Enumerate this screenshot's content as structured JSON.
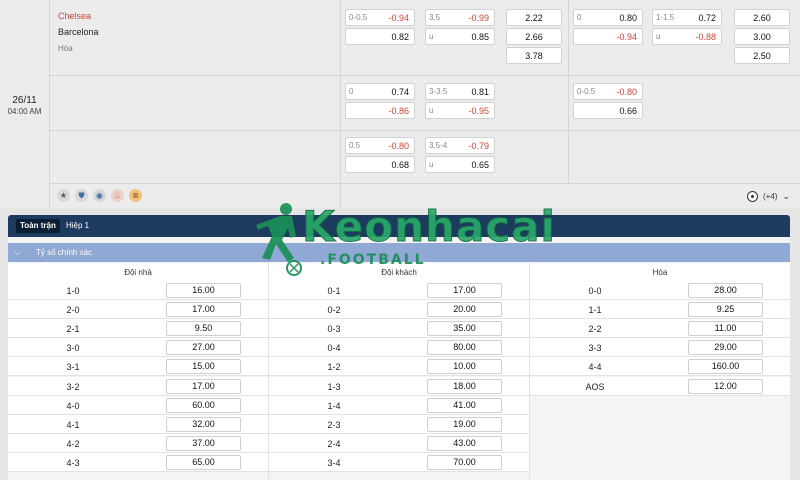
{
  "match": {
    "date": "26/11",
    "time": "04:00 AM",
    "home": "Chelsea",
    "away": "Barcelona",
    "draw": "Hòa",
    "more_count": "(+4)"
  },
  "odds": {
    "r1_hcap": {
      "h1": "0-0.5",
      "v1": "-0.94",
      "h2": "",
      "v2": "0.82"
    },
    "r1_ou": {
      "h1": "3.5",
      "v1": "-0.99",
      "h2": "u",
      "v2": "0.85"
    },
    "r1_1x2": {
      "v1": "2.22",
      "v2": "2.66",
      "v3": "3.78"
    },
    "r1_h1_hcap": {
      "h1": "0",
      "v1": "0.80",
      "h2": "",
      "v2": "-0.94"
    },
    "r1_h1_ou": {
      "h1": "1-1.5",
      "v1": "0.72",
      "h2": "u",
      "v2": "-0.88"
    },
    "r1_h1_1x2": {
      "v1": "2.60",
      "v2": "3.00",
      "v3": "2.50"
    },
    "r2_hcap": {
      "h1": "0",
      "v1": "0.74",
      "h2": "",
      "v2": "-0.86"
    },
    "r2_ou": {
      "h1": "3-3.5",
      "v1": "0.81",
      "h2": "u",
      "v2": "-0.95"
    },
    "r2_h1_hcap": {
      "h1": "0-0.5",
      "v1": "-0.80",
      "h2": "",
      "v2": "0.66"
    },
    "r3_hcap": {
      "h1": "0.5",
      "v1": "-0.80",
      "h2": "",
      "v2": "0.68"
    },
    "r3_ou": {
      "h1": "3.5-4",
      "v1": "-0.79",
      "h2": "u",
      "v2": "0.65"
    }
  },
  "tabs": [
    "Toàn trận",
    "Hiệp 1"
  ],
  "section_title": "Tỷ số chính xác",
  "columns": [
    "Đội nhà",
    "Đội khách",
    "Hòa"
  ],
  "home_scores": [
    [
      "1-0",
      "16.00"
    ],
    [
      "2-0",
      "17.00"
    ],
    [
      "2-1",
      "9.50"
    ],
    [
      "3-0",
      "27.00"
    ],
    [
      "3-1",
      "15.00"
    ],
    [
      "3-2",
      "17.00"
    ],
    [
      "4-0",
      "60.00"
    ],
    [
      "4-1",
      "32.00"
    ],
    [
      "4-2",
      "37.00"
    ],
    [
      "4-3",
      "65.00"
    ]
  ],
  "away_scores": [
    [
      "0-1",
      "17.00"
    ],
    [
      "0-2",
      "20.00"
    ],
    [
      "0-3",
      "35.00"
    ],
    [
      "0-4",
      "80.00"
    ],
    [
      "1-2",
      "10.00"
    ],
    [
      "1-3",
      "18.00"
    ],
    [
      "1-4",
      "41.00"
    ],
    [
      "2-3",
      "19.00"
    ],
    [
      "2-4",
      "43.00"
    ],
    [
      "3-4",
      "70.00"
    ]
  ],
  "draw_scores": [
    [
      "0-0",
      "28.00"
    ],
    [
      "1-1",
      "9.25"
    ],
    [
      "2-2",
      "11.00"
    ],
    [
      "3-3",
      "29.00"
    ],
    [
      "4-4",
      "160.00"
    ],
    [
      "AOS",
      "12.00"
    ]
  ],
  "watermark": {
    "main": "Keonhacai",
    "sub": ".FOOTBALL"
  },
  "colors": {
    "negative": "#d0453a",
    "header": "#1d3a5f",
    "section": "#8fa8d4"
  }
}
